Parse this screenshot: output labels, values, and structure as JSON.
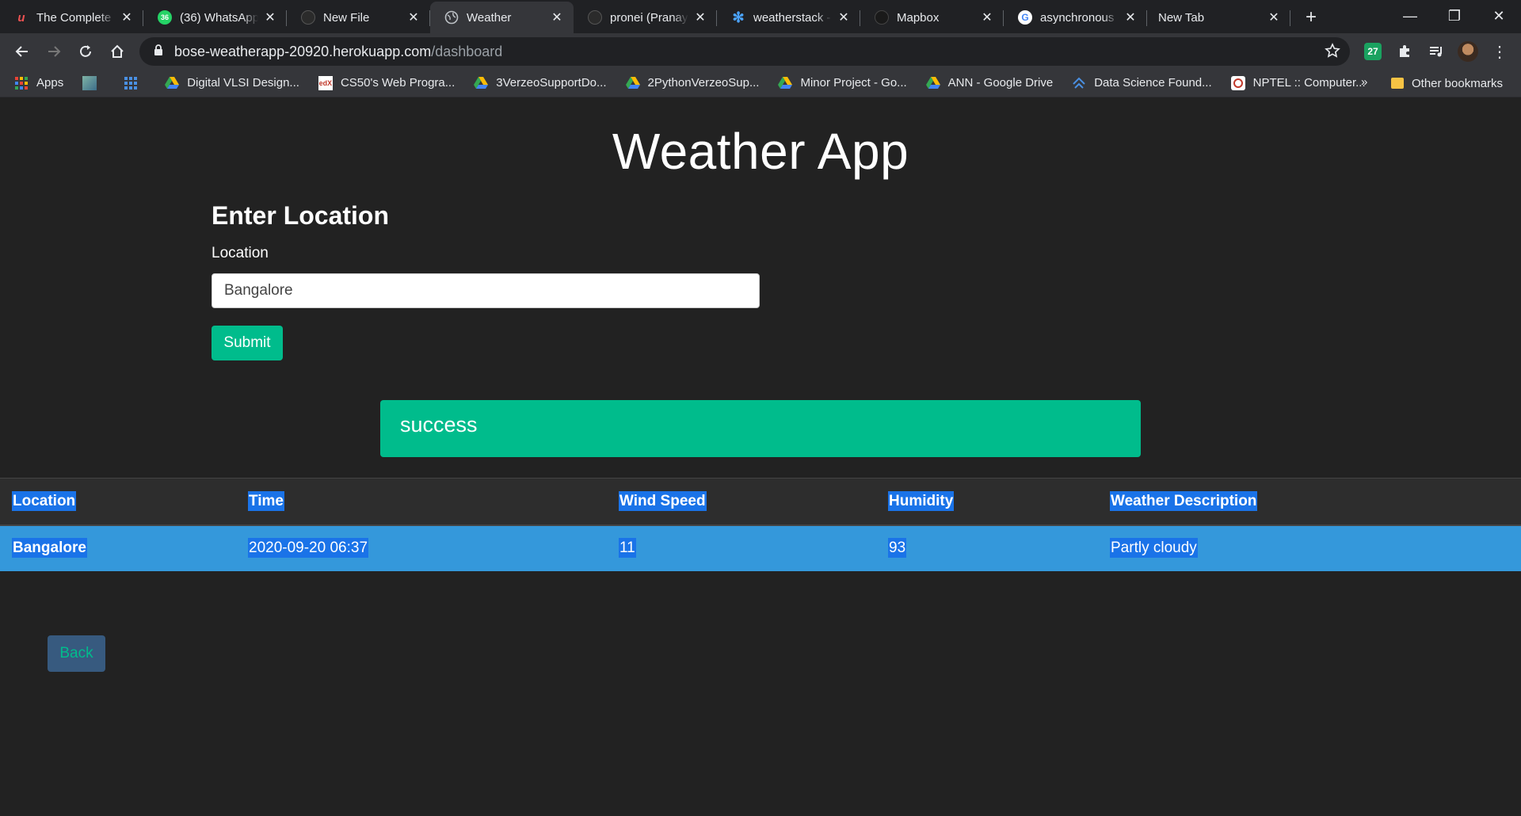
{
  "browser": {
    "tabs": [
      {
        "title": "The Complete Web Developer",
        "icon": "udemy-icon",
        "active": false
      },
      {
        "title": "(36) WhatsApp",
        "icon": "whatsapp-icon",
        "active": false
      },
      {
        "title": "New File",
        "icon": "github-icon",
        "active": false
      },
      {
        "title": "Weather",
        "icon": "globe-icon",
        "active": true
      },
      {
        "title": "pronei (Pranay",
        "icon": "github-icon",
        "active": false
      },
      {
        "title": "weatherstack - Real-Time",
        "icon": "weatherstack-icon",
        "active": false
      },
      {
        "title": "Mapbox",
        "icon": "mapbox-icon",
        "active": false
      },
      {
        "title": "asynchronous - Google",
        "icon": "google-icon",
        "active": false
      },
      {
        "title": "New Tab",
        "icon": "",
        "active": false
      }
    ],
    "url_host": "bose-weatherapp-20920.herokuapp.com",
    "url_path": "/dashboard",
    "extension_badge": "27",
    "bookmarks": [
      {
        "label": "Apps",
        "icon": "apps-grid-icon"
      },
      {
        "label": "",
        "icon": "image-bookmark-icon"
      },
      {
        "label": "",
        "icon": "apps-grid-blue-icon"
      },
      {
        "label": "Digital VLSI Design...",
        "icon": "drive-icon"
      },
      {
        "label": "CS50's Web Progra...",
        "icon": "edx-icon"
      },
      {
        "label": "3VerzeoSupportDo...",
        "icon": "drive-icon"
      },
      {
        "label": "2PythonVerzeoSup...",
        "icon": "drive-icon"
      },
      {
        "label": "Minor Project - Go...",
        "icon": "drive-icon"
      },
      {
        "label": "ANN - Google Drive",
        "icon": "drive-icon"
      },
      {
        "label": "Data Science Found...",
        "icon": "coursera-icon"
      },
      {
        "label": "NPTEL :: Computer...",
        "icon": "nptel-icon"
      }
    ],
    "bookmarks_more": "»",
    "other_bookmarks": "Other bookmarks"
  },
  "page": {
    "title": "Weather App",
    "form_heading": "Enter Location",
    "location_label": "Location",
    "location_value": "Bangalore",
    "submit_label": "Submit",
    "alert_text": "success",
    "table": {
      "headers": [
        "Location",
        "Time",
        "Wind Speed",
        "Humidity",
        "Weather Description"
      ],
      "rows": [
        [
          "Bangalore",
          "2020-09-20 06:37",
          "11",
          "93",
          "Partly cloudy"
        ]
      ]
    },
    "back_label": "Back"
  },
  "colors": {
    "page_bg": "#222222",
    "success": "#00bc8c",
    "row_highlight": "#3498db",
    "selection": "#1a73e8",
    "back_button": "#375a7f"
  }
}
